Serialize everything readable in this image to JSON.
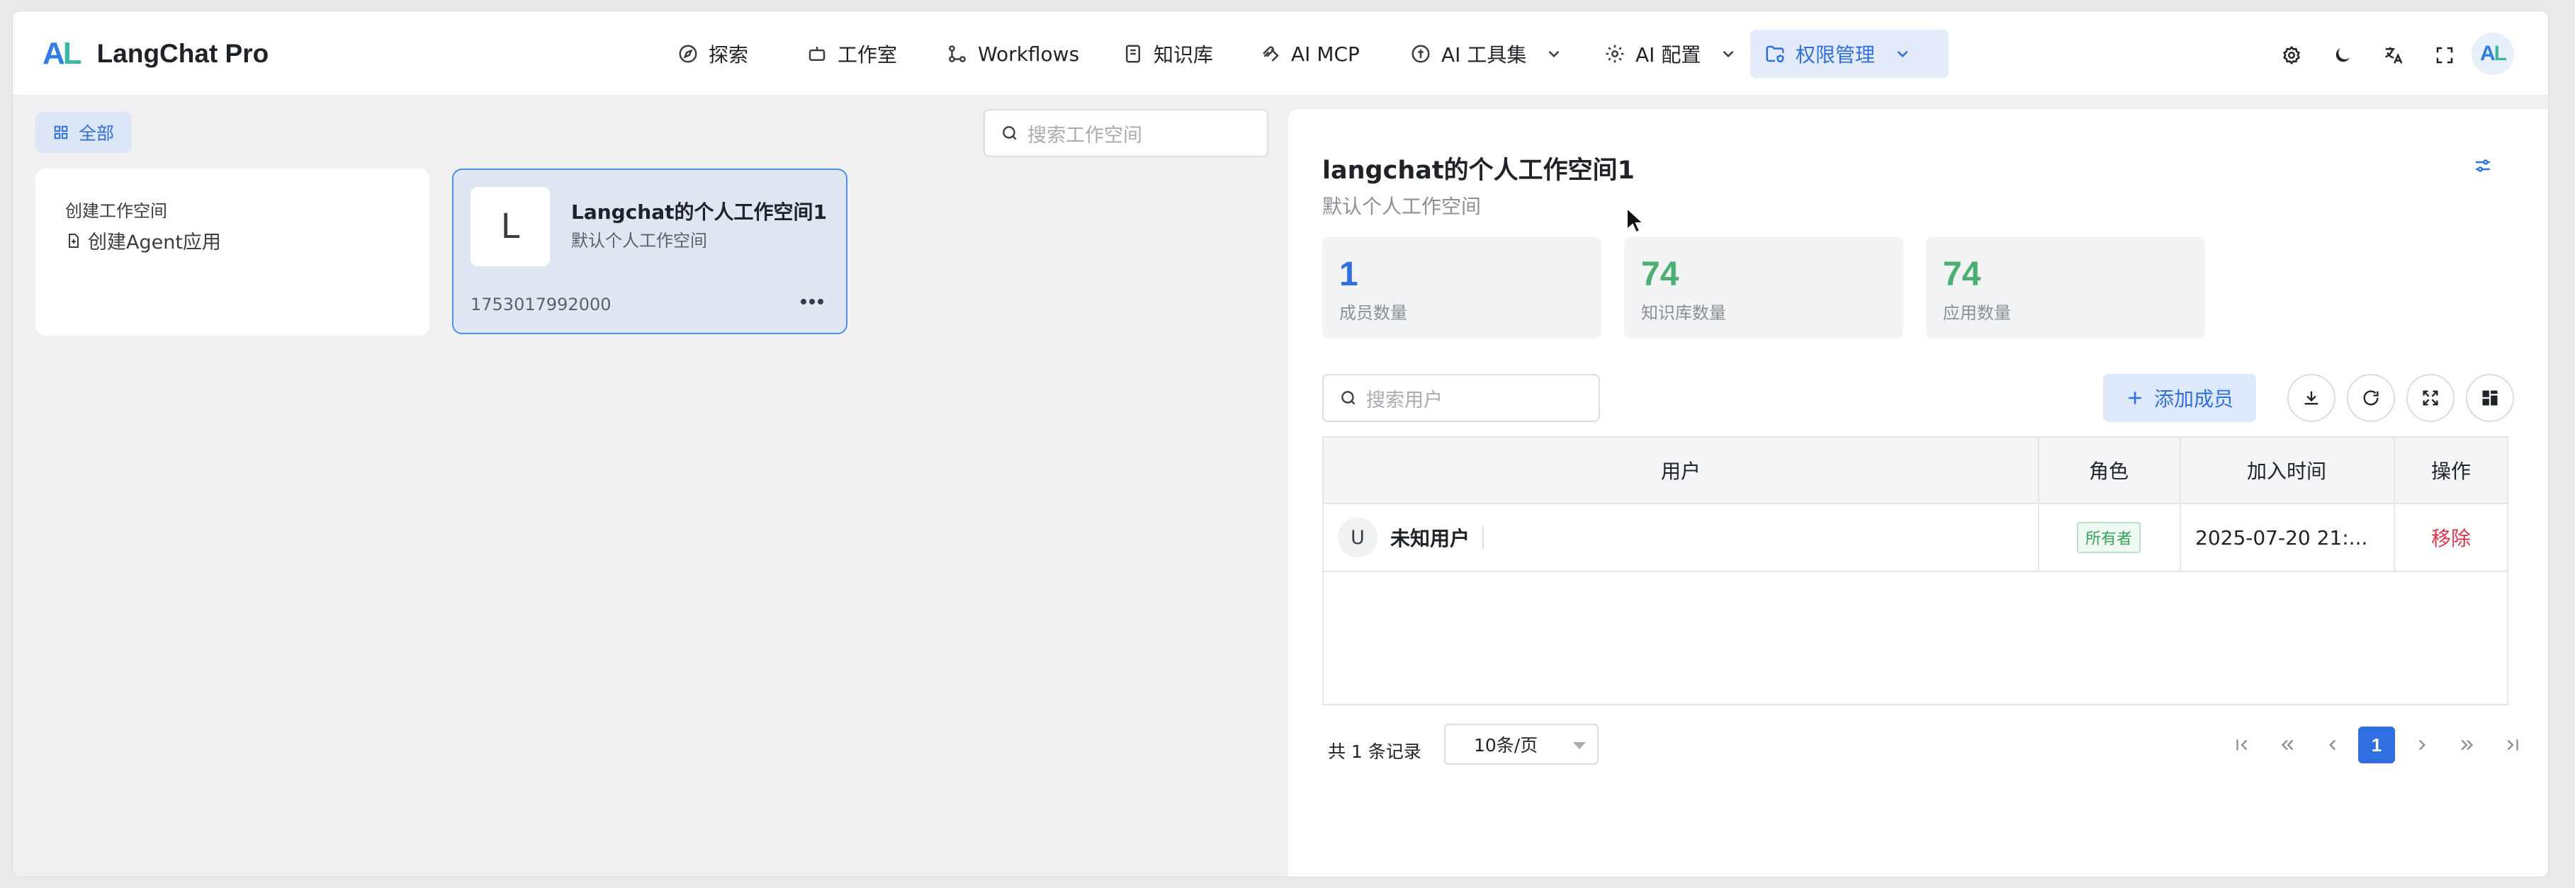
{
  "app": {
    "brand_mark_a": "A",
    "brand_mark_l": "L",
    "title": "LangChat Pro"
  },
  "nav": [
    {
      "label": "探索",
      "icon": "compass-icon"
    },
    {
      "label": "工作室",
      "icon": "robot-icon"
    },
    {
      "label": "Workflows",
      "icon": "workflow-icon"
    },
    {
      "label": "知识库",
      "icon": "book-icon"
    },
    {
      "label": "AI MCP",
      "icon": "mcp-icon"
    },
    {
      "label": "AI 工具集",
      "icon": "tools-icon",
      "dropdown": true
    },
    {
      "label": "AI 配置",
      "icon": "gear-icon",
      "dropdown": true
    },
    {
      "label": "权限管理",
      "icon": "folder-shield-icon",
      "dropdown": true,
      "active": true
    }
  ],
  "header_icons": [
    "settings-icon",
    "moon-icon",
    "translate-icon",
    "fullscreen-icon"
  ],
  "user_avatar": {
    "a": "A",
    "l": "L"
  },
  "filter": {
    "all_label": "全部"
  },
  "workspace_search": {
    "placeholder": "搜索工作空间"
  },
  "create_card": {
    "title": "创建工作空间",
    "item": "创建Agent应用"
  },
  "workspace_card": {
    "letter": "L",
    "name": "Langchat的个人工作空间1",
    "desc": "默认个人工作空间",
    "id": "1753017992000"
  },
  "detail": {
    "title": "langchat的个人工作空间1",
    "desc": "默认个人工作空间",
    "stats": [
      {
        "value": "1",
        "label": "成员数量",
        "color": "#2f6fe0"
      },
      {
        "value": "74",
        "label": "知识库数量",
        "color": "#4caf72"
      },
      {
        "value": "74",
        "label": "应用数量",
        "color": "#4caf72"
      }
    ],
    "user_search_placeholder": "搜索用户",
    "add_member_label": "添加成员",
    "table": {
      "headers": {
        "user": "用户",
        "role": "角色",
        "joined": "加入时间",
        "action": "操作"
      },
      "rows": [
        {
          "avatar": "U",
          "user": "未知用户",
          "role": "所有者",
          "joined": "2025-07-20 21:...",
          "action": "移除"
        }
      ]
    },
    "pager": {
      "total": "共 1 条记录",
      "page_size": "10条/页",
      "current_page": "1"
    }
  },
  "colors": {
    "accent": "#2f6fe0",
    "stat_blue": "#2f6fe0",
    "stat_green": "#4caf72",
    "danger": "#e0334d"
  }
}
